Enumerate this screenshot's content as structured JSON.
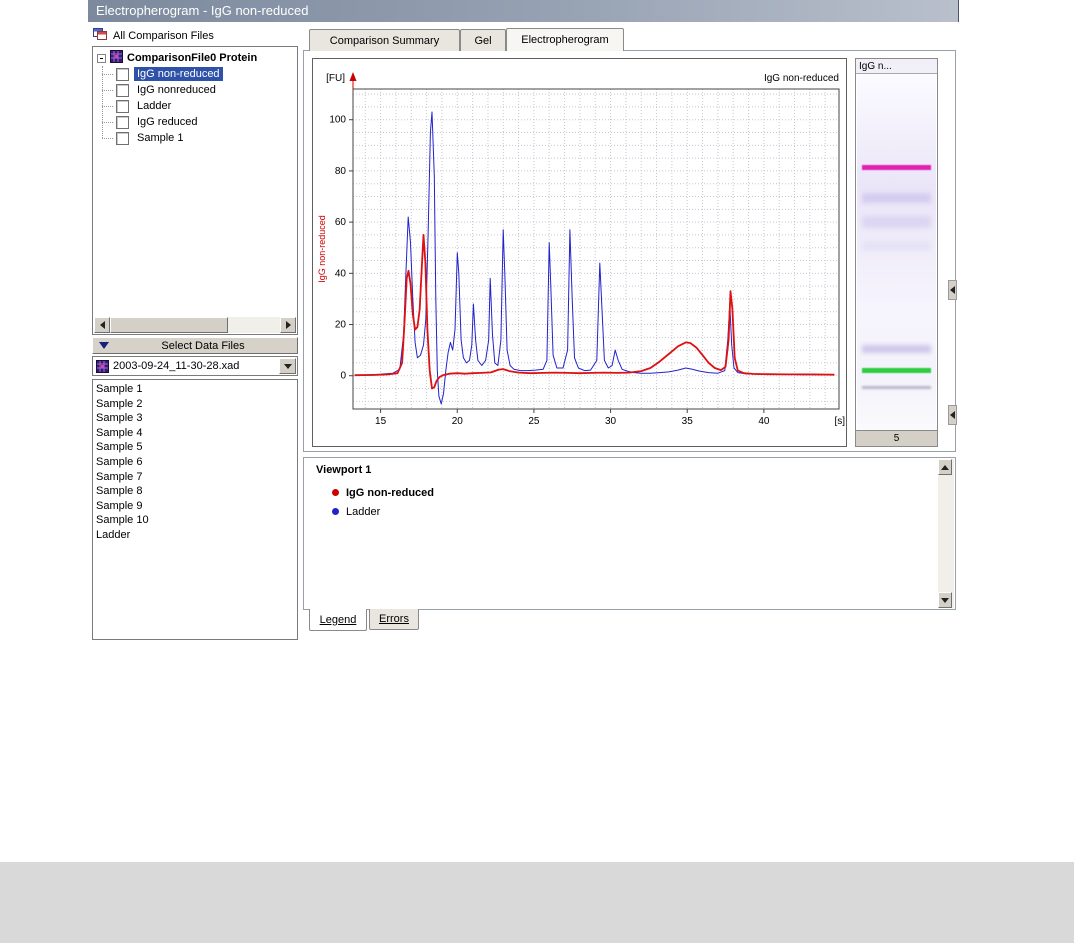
{
  "titlebar": {
    "title": "Electropherogram - IgG non-reduced"
  },
  "left_panel": {
    "comparison_header": "All Comparison Files",
    "tree": {
      "root": "ComparisonFile0 Protein",
      "items": [
        {
          "label": "IgG non-reduced",
          "selected": true
        },
        {
          "label": "IgG nonreduced",
          "selected": false
        },
        {
          "label": "Ladder",
          "selected": false
        },
        {
          "label": "IgG reduced",
          "selected": false
        },
        {
          "label": "Sample 1",
          "selected": false
        }
      ]
    },
    "select_data_files": "Select Data Files",
    "file_combo": "2003-09-24_11-30-28.xad",
    "file_list": [
      "Sample 1",
      "Sample 2",
      "Sample 3",
      "Sample 4",
      "Sample 5",
      "Sample 6",
      "Sample 7",
      "Sample 8",
      "Sample 9",
      "Sample 10",
      "Ladder"
    ]
  },
  "tabs": [
    {
      "label": "Comparison Summary",
      "active": false
    },
    {
      "label": "Gel",
      "active": false
    },
    {
      "label": "Electropherogram",
      "active": true
    }
  ],
  "chart_data": {
    "type": "line",
    "title": "IgG non-reduced",
    "corner_title": "IgG non-reduced",
    "ylabel": "IgG non-reduced",
    "y_unit": "[FU]",
    "x_unit": "[s]",
    "xlabel": "",
    "xlim": [
      13.2,
      44.9
    ],
    "ylim": [
      -13,
      112
    ],
    "xticks": [
      15,
      20,
      25,
      30,
      35,
      40
    ],
    "yticks": [
      0,
      20,
      40,
      60,
      80,
      100
    ],
    "grid": "dotted",
    "legend_position": "separate-panel",
    "series": [
      {
        "name": "Ladder",
        "color": "#2222cc",
        "width": 1,
        "points": [
          [
            13.3,
            0.3
          ],
          [
            14.2,
            0.4
          ],
          [
            15.0,
            0.6
          ],
          [
            15.8,
            1.0
          ],
          [
            16.25,
            2.5
          ],
          [
            16.5,
            16
          ],
          [
            16.65,
            40
          ],
          [
            16.8,
            62
          ],
          [
            16.95,
            52
          ],
          [
            17.1,
            30
          ],
          [
            17.25,
            13
          ],
          [
            17.4,
            7
          ],
          [
            17.6,
            8
          ],
          [
            17.8,
            12
          ],
          [
            17.95,
            22
          ],
          [
            18.1,
            55
          ],
          [
            18.25,
            95
          ],
          [
            18.35,
            103
          ],
          [
            18.5,
            78
          ],
          [
            18.6,
            30
          ],
          [
            18.7,
            2
          ],
          [
            18.8,
            -8
          ],
          [
            18.95,
            -11
          ],
          [
            19.1,
            -7
          ],
          [
            19.25,
            2
          ],
          [
            19.4,
            9
          ],
          [
            19.55,
            13
          ],
          [
            19.7,
            10
          ],
          [
            19.85,
            18
          ],
          [
            20.0,
            48
          ],
          [
            20.1,
            40
          ],
          [
            20.25,
            14
          ],
          [
            20.4,
            7
          ],
          [
            20.6,
            5
          ],
          [
            20.8,
            6
          ],
          [
            20.95,
            12
          ],
          [
            21.05,
            28
          ],
          [
            21.2,
            14
          ],
          [
            21.35,
            6
          ],
          [
            21.6,
            4
          ],
          [
            21.85,
            6
          ],
          [
            22.05,
            14
          ],
          [
            22.15,
            38
          ],
          [
            22.3,
            16
          ],
          [
            22.45,
            5
          ],
          [
            22.65,
            4
          ],
          [
            22.85,
            14
          ],
          [
            23.0,
            57
          ],
          [
            23.1,
            40
          ],
          [
            23.25,
            10
          ],
          [
            23.45,
            4
          ],
          [
            23.7,
            2.5
          ],
          [
            24.1,
            2
          ],
          [
            24.6,
            2
          ],
          [
            25.1,
            2.2
          ],
          [
            25.6,
            2.5
          ],
          [
            25.85,
            6
          ],
          [
            26.0,
            52
          ],
          [
            26.1,
            35
          ],
          [
            26.25,
            8
          ],
          [
            26.5,
            3
          ],
          [
            26.9,
            3
          ],
          [
            27.2,
            10
          ],
          [
            27.35,
            57
          ],
          [
            27.5,
            30
          ],
          [
            27.65,
            7
          ],
          [
            27.9,
            3
          ],
          [
            28.3,
            2
          ],
          [
            28.7,
            2.2
          ],
          [
            29.1,
            6
          ],
          [
            29.3,
            44
          ],
          [
            29.45,
            25
          ],
          [
            29.6,
            6
          ],
          [
            29.85,
            3
          ],
          [
            30.1,
            4
          ],
          [
            30.3,
            10
          ],
          [
            30.5,
            6
          ],
          [
            30.75,
            2.5
          ],
          [
            31.1,
            1.8
          ],
          [
            31.5,
            1.2
          ],
          [
            32.0,
            1.0
          ],
          [
            32.6,
            1.0
          ],
          [
            33.2,
            1.2
          ],
          [
            33.8,
            1.5
          ],
          [
            34.4,
            2.2
          ],
          [
            34.9,
            3.0
          ],
          [
            35.3,
            2.6
          ],
          [
            35.8,
            1.8
          ],
          [
            36.4,
            1.2
          ],
          [
            37.0,
            1.0
          ],
          [
            37.45,
            2
          ],
          [
            37.65,
            14
          ],
          [
            37.78,
            28
          ],
          [
            37.9,
            12
          ],
          [
            38.05,
            3
          ],
          [
            38.3,
            1.2
          ],
          [
            38.8,
            0.8
          ],
          [
            39.5,
            0.6
          ],
          [
            40.5,
            0.5
          ],
          [
            41.5,
            0.5
          ],
          [
            42.5,
            0.4
          ],
          [
            43.5,
            0.4
          ],
          [
            44.6,
            0.3
          ]
        ]
      },
      {
        "name": "IgG non-reduced",
        "color": "#dd1111",
        "width": 1.8,
        "points": [
          [
            13.3,
            0.2
          ],
          [
            14.5,
            0.3
          ],
          [
            15.5,
            0.5
          ],
          [
            16.1,
            1.0
          ],
          [
            16.4,
            5
          ],
          [
            16.55,
            20
          ],
          [
            16.7,
            38
          ],
          [
            16.82,
            41
          ],
          [
            16.95,
            36
          ],
          [
            17.1,
            24
          ],
          [
            17.25,
            18
          ],
          [
            17.4,
            19
          ],
          [
            17.55,
            26
          ],
          [
            17.7,
            44
          ],
          [
            17.8,
            55
          ],
          [
            17.92,
            44
          ],
          [
            18.05,
            18
          ],
          [
            18.2,
            2
          ],
          [
            18.35,
            -5
          ],
          [
            18.5,
            -4.5
          ],
          [
            18.65,
            -2
          ],
          [
            18.85,
            -0.5
          ],
          [
            19.1,
            0.3
          ],
          [
            19.5,
            0.8
          ],
          [
            20.0,
            1.0
          ],
          [
            20.5,
            0.8
          ],
          [
            21.0,
            1.0
          ],
          [
            21.6,
            1.1
          ],
          [
            22.2,
            1.3
          ],
          [
            22.7,
            2.4
          ],
          [
            23.0,
            2.6
          ],
          [
            23.4,
            1.8
          ],
          [
            24.0,
            1.2
          ],
          [
            24.8,
            1.0
          ],
          [
            25.6,
            1.1
          ],
          [
            26.4,
            1.2
          ],
          [
            27.2,
            1.1
          ],
          [
            28.0,
            1.0
          ],
          [
            28.8,
            1.1
          ],
          [
            29.6,
            1.2
          ],
          [
            30.4,
            1.1
          ],
          [
            31.2,
            1.2
          ],
          [
            32.0,
            1.8
          ],
          [
            32.6,
            3.0
          ],
          [
            33.2,
            5.5
          ],
          [
            33.8,
            8.5
          ],
          [
            34.4,
            11.5
          ],
          [
            34.9,
            13.0
          ],
          [
            35.2,
            12.8
          ],
          [
            35.6,
            11.0
          ],
          [
            36.0,
            8.0
          ],
          [
            36.4,
            5.0
          ],
          [
            36.8,
            3.0
          ],
          [
            37.2,
            2.2
          ],
          [
            37.5,
            3.5
          ],
          [
            37.7,
            14
          ],
          [
            37.82,
            33
          ],
          [
            37.95,
            26
          ],
          [
            38.1,
            7
          ],
          [
            38.3,
            2.0
          ],
          [
            38.7,
            1.0
          ],
          [
            39.3,
            0.7
          ],
          [
            40.2,
            0.6
          ],
          [
            41.5,
            0.5
          ],
          [
            43.0,
            0.5
          ],
          [
            44.6,
            0.4
          ]
        ]
      }
    ]
  },
  "gel_strip": {
    "header": "IgG n...",
    "lane_number": "5",
    "bands": [
      {
        "pos": 0.255,
        "height": 5,
        "color": "#e020b0",
        "blur": 0.5
      },
      {
        "pos": 0.335,
        "height": 10,
        "color": "#d4cdf0",
        "blur": 2
      },
      {
        "pos": 0.4,
        "height": 12,
        "color": "#dcd6f2",
        "blur": 2.5
      },
      {
        "pos": 0.47,
        "height": 10,
        "color": "#e6e2f6",
        "blur": 2.5
      },
      {
        "pos": 0.76,
        "height": 8,
        "color": "#cfc8ea",
        "blur": 2
      },
      {
        "pos": 0.825,
        "height": 5,
        "color": "#2ecc40",
        "blur": 0.5
      },
      {
        "pos": 0.875,
        "height": 3,
        "color": "#b9b4c9",
        "blur": 1
      }
    ]
  },
  "legend_panel": {
    "title": "Viewport 1",
    "entries": [
      {
        "label": "IgG non-reduced",
        "color": "#cc0000",
        "bold": true
      },
      {
        "label": "Ladder",
        "color": "#2222cc",
        "bold": false
      }
    ]
  },
  "bottom_tabs": [
    {
      "label": "Legend",
      "active": true
    },
    {
      "label": "Errors",
      "active": false
    }
  ]
}
